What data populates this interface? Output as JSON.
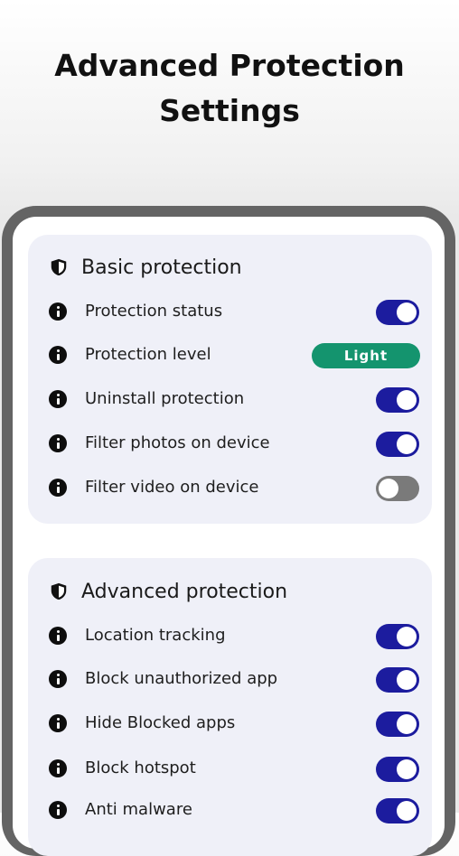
{
  "headline": {
    "line1": "Advanced Protection",
    "line2": "Settings"
  },
  "colors": {
    "toggle_on": "#1c1c9e",
    "toggle_off": "#7a7a7a",
    "pill": "#14946e",
    "card_bg": "#eff0f8"
  },
  "basic": {
    "title": "Basic protection",
    "icon": "shield-icon",
    "rows": [
      {
        "label": "Protection status",
        "control": "toggle",
        "on": true
      },
      {
        "label": "Protection level",
        "control": "pill",
        "value": "Light"
      },
      {
        "label": "Uninstall protection",
        "control": "toggle",
        "on": true
      },
      {
        "label": "Filter photos on device",
        "control": "toggle",
        "on": true
      },
      {
        "label": "Filter video on device",
        "control": "toggle",
        "on": false
      }
    ]
  },
  "advanced": {
    "title": "Advanced protection",
    "icon": "shield-icon",
    "rows": [
      {
        "label": "Location tracking",
        "control": "toggle",
        "on": true
      },
      {
        "label": "Block unauthorized app",
        "control": "toggle",
        "on": true
      },
      {
        "label": "Hide Blocked apps",
        "control": "toggle",
        "on": true
      },
      {
        "label": "Block hotspot",
        "control": "toggle",
        "on": true
      },
      {
        "label": "Anti malware",
        "control": "toggle",
        "on": true
      }
    ]
  }
}
